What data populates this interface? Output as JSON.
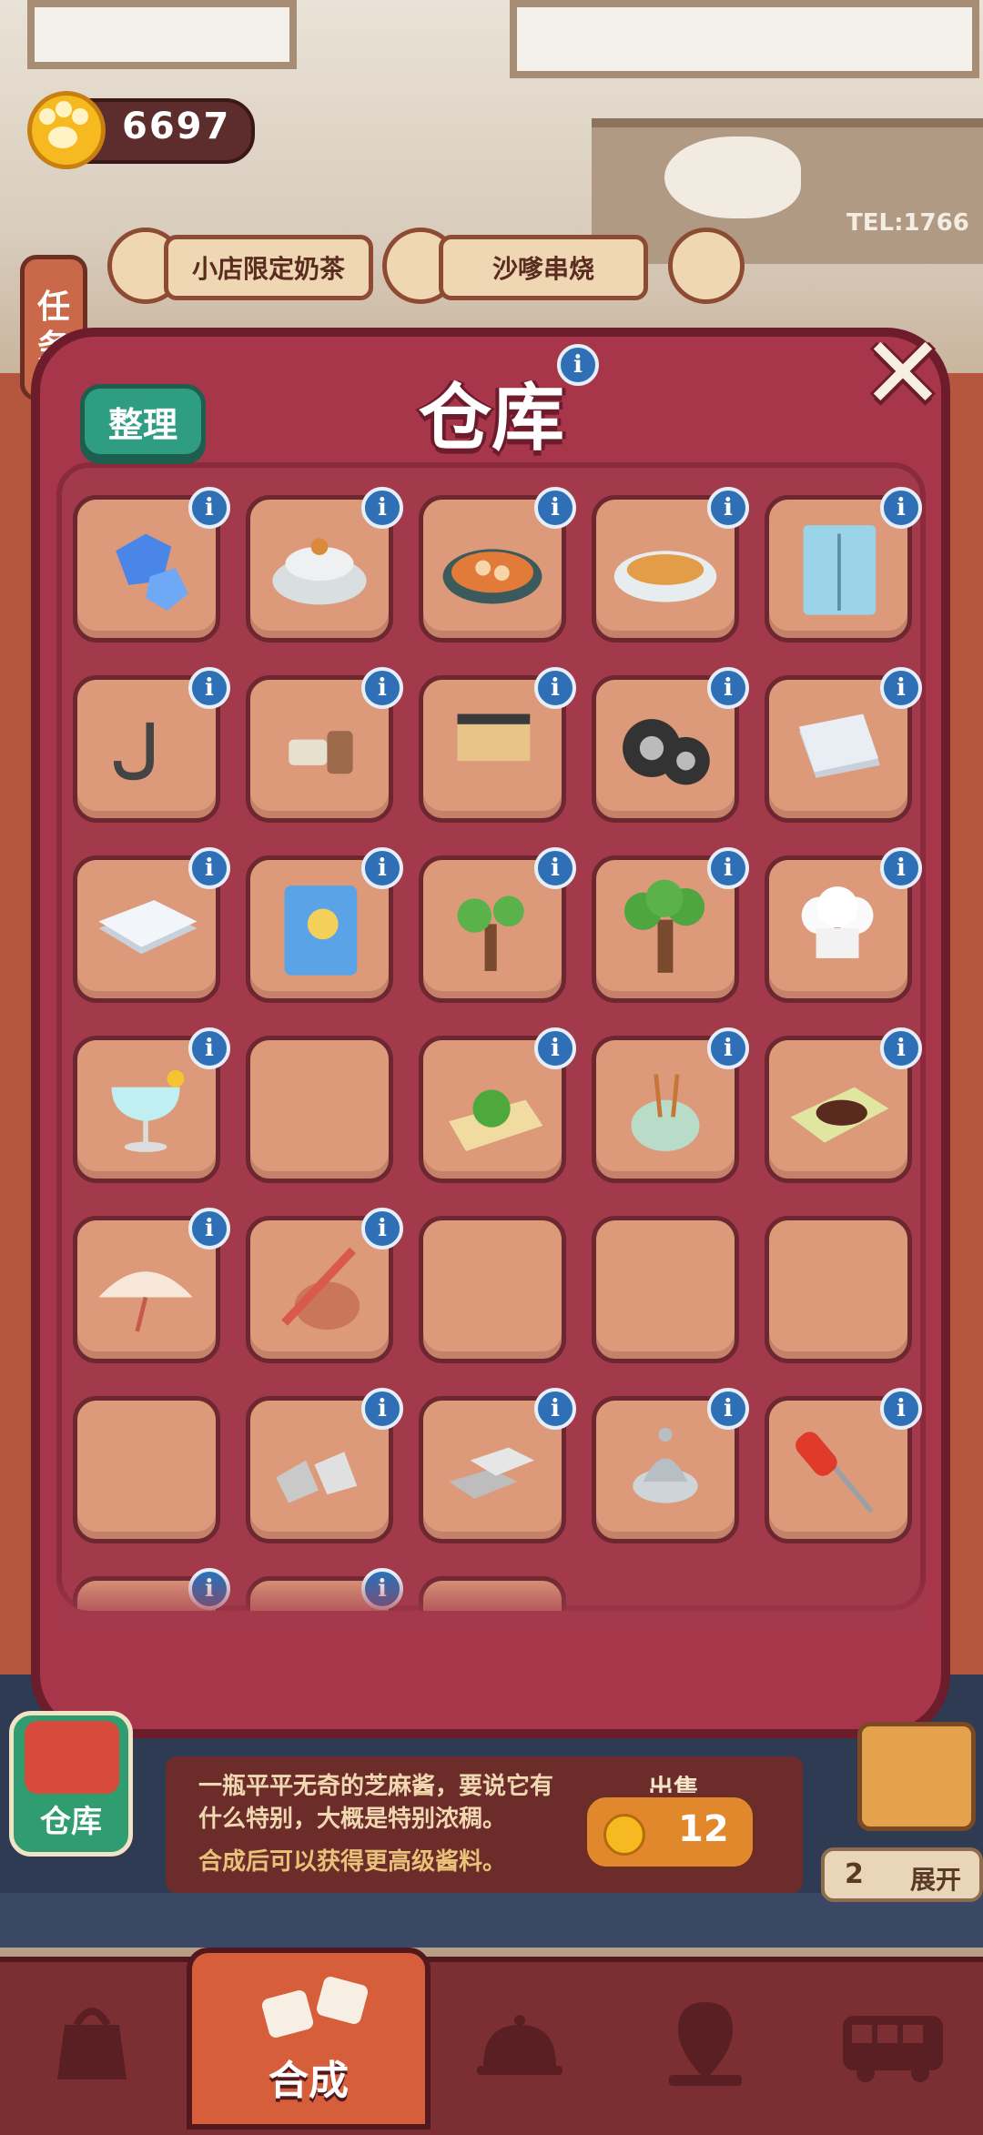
{
  "currency": {
    "amount": "6697",
    "icon": "paw-coin-icon"
  },
  "task_button": {
    "label_line1": "任",
    "label_line2": "务"
  },
  "orders": [
    {
      "label": "小店限定奶茶",
      "icon": "milk-tea-icon"
    },
    {
      "label": "沙嗲串烧",
      "icon": "skewer-icon"
    }
  ],
  "warehouse": {
    "title": "仓库",
    "sort_label": "整理",
    "slots": [
      {
        "icon": "ice-gems-icon",
        "filled": true
      },
      {
        "icon": "clay-pot-icon",
        "filled": true
      },
      {
        "icon": "hotpot-skillet-icon",
        "filled": true
      },
      {
        "icon": "soup-bowl-icon",
        "filled": true
      },
      {
        "icon": "fridge-cabinet-icon",
        "filled": true
      },
      {
        "icon": "wall-hook-icon",
        "filled": true
      },
      {
        "icon": "power-plug-icon",
        "filled": true
      },
      {
        "icon": "wall-shelf-icon",
        "filled": true
      },
      {
        "icon": "tires-icon",
        "filled": true
      },
      {
        "icon": "paper-stack-small-icon",
        "filled": true
      },
      {
        "icon": "paper-stack-icon",
        "filled": true
      },
      {
        "icon": "notebook-icon",
        "filled": true
      },
      {
        "icon": "small-tree-icon",
        "filled": true
      },
      {
        "icon": "big-tree-icon",
        "filled": true
      },
      {
        "icon": "chef-hat-icon",
        "filled": true
      },
      {
        "icon": "cocktail-icon",
        "filled": true
      },
      {
        "icon": "empty-slot",
        "filled": false
      },
      {
        "icon": "herb-board-icon",
        "filled": true
      },
      {
        "icon": "rice-cooker-skewers-icon",
        "filled": true
      },
      {
        "icon": "seaweed-mat-icon",
        "filled": true
      },
      {
        "icon": "paper-umbrella-icon",
        "filled": true
      },
      {
        "icon": "fishing-basket-icon",
        "filled": true
      },
      {
        "icon": "empty-slot",
        "filled": false
      },
      {
        "icon": "empty-slot",
        "filled": false
      },
      {
        "icon": "empty-slot",
        "filled": false
      },
      {
        "icon": "empty-slot",
        "filled": false
      },
      {
        "icon": "iron-ore-icon",
        "filled": true
      },
      {
        "icon": "silver-bars-icon",
        "filled": true
      },
      {
        "icon": "metal-lamp-cap-icon",
        "filled": true
      },
      {
        "icon": "screwdriver-icon",
        "filled": true
      },
      {
        "icon": "gold-item-icon",
        "filled": true
      },
      {
        "icon": "blue-item-icon",
        "filled": true
      },
      {
        "icon": "partial-slot",
        "filled": false
      }
    ]
  },
  "side_warehouse": {
    "label": "仓库"
  },
  "item_detail": {
    "description": "一瓶平平无奇的芝麻酱，要说它有什么特别，大概是特别浓稠。",
    "hint": "合成后可以获得更高级酱料。",
    "sell_label": "出售",
    "sell_price": "12"
  },
  "expand": {
    "count": "2",
    "label": "展开"
  },
  "nav": {
    "items": [
      {
        "icon": "shop-bag-icon"
      },
      {
        "icon": "merge-icon",
        "label": "合成",
        "active": true
      },
      {
        "icon": "service-bell-icon"
      },
      {
        "icon": "map-pin-icon"
      },
      {
        "icon": "bus-icon"
      }
    ]
  },
  "colors": {
    "dialog": "#a8364a",
    "slot": "#dc9a7b",
    "info_badge": "#2f6fb5",
    "sort_button": "#2f9d82"
  }
}
